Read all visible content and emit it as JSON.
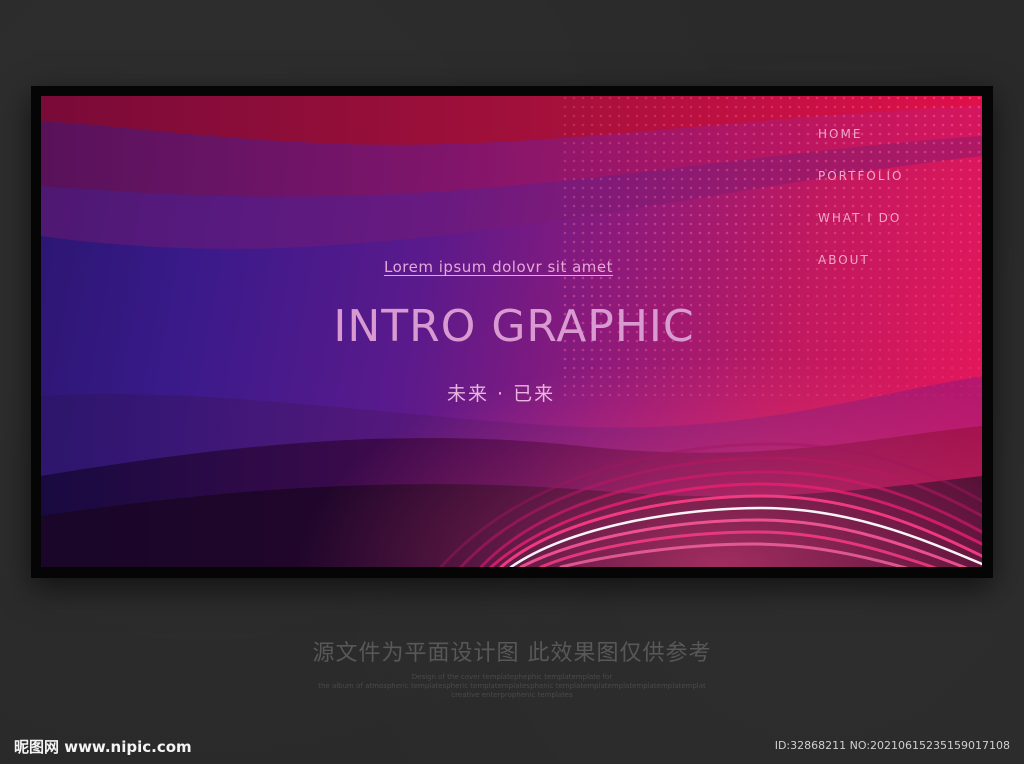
{
  "nav": {
    "items": [
      {
        "label": "HOME"
      },
      {
        "label": "PORTFOLIO"
      },
      {
        "label": "WHAT I DO"
      },
      {
        "label": "ABOUT"
      }
    ]
  },
  "hero": {
    "tagline": "Lorem ipsum dolovr sit amet",
    "title": "INTRO GRAPHIC",
    "subtitle": "未来 · 已来"
  },
  "footer": {
    "caption": "源文件为平面设计图 此效果图仅供参考",
    "fine_lines": [
      "Design of the cover templatephephic templatemplate for",
      "the album of atmospheric templatespheric templatemplatesphenic templatemplatemplatemplatemplatemplat",
      "creative enterprophenic templates"
    ]
  },
  "watermark": {
    "left": "昵图网 www.nipic.com",
    "right": "ID:32868211 NO:20210615235159017108"
  },
  "colors": {
    "page_bg": "#2a2a2a",
    "frame": "#050505",
    "gradient_left": "#2a1670",
    "gradient_mid": "#8a1a7c",
    "gradient_right": "#e8165a",
    "nav_text": "#f0a8c8",
    "title_text": "#d89ad0"
  }
}
